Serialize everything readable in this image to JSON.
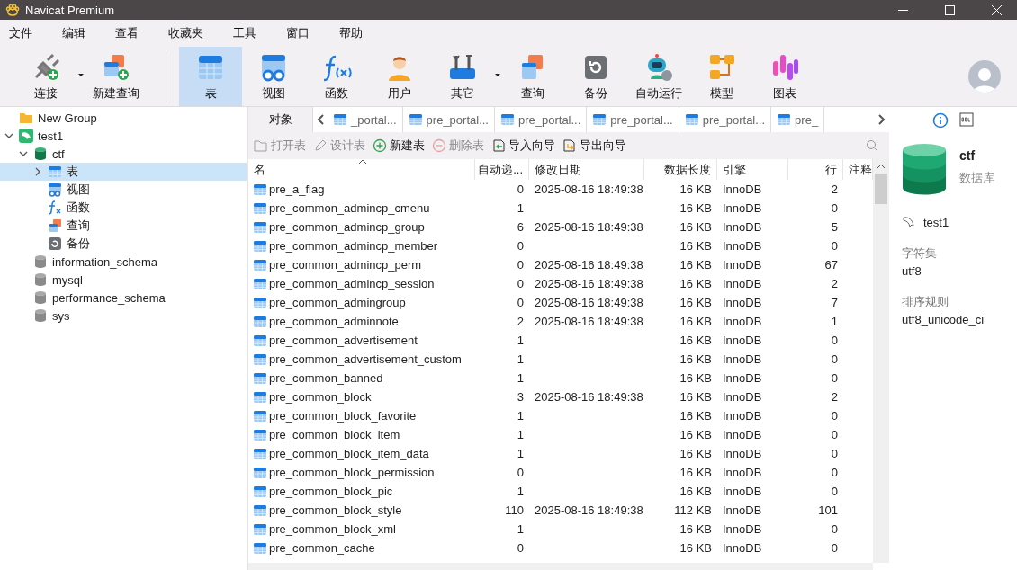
{
  "window": {
    "title": "Navicat Premium"
  },
  "menu": [
    "文件",
    "编辑",
    "查看",
    "收藏夹",
    "工具",
    "窗口",
    "帮助"
  ],
  "toolbar": [
    {
      "kind": "connect",
      "label": "连接",
      "has_menu": true,
      "selected": false
    },
    {
      "kind": "new-query",
      "label": "新建查询",
      "has_menu": false,
      "selected": false
    },
    {
      "kind": "table",
      "label": "表",
      "has_menu": false,
      "selected": true
    },
    {
      "kind": "view",
      "label": "视图",
      "has_menu": false,
      "selected": false
    },
    {
      "kind": "function",
      "label": "函数",
      "has_menu": false,
      "selected": false
    },
    {
      "kind": "user",
      "label": "用户",
      "has_menu": false,
      "selected": false
    },
    {
      "kind": "other",
      "label": "其它",
      "has_menu": true,
      "selected": false
    },
    {
      "kind": "query",
      "label": "查询",
      "has_menu": false,
      "selected": false
    },
    {
      "kind": "backup",
      "label": "备份",
      "has_menu": false,
      "selected": false
    },
    {
      "kind": "automation",
      "label": "自动运行",
      "has_menu": false,
      "selected": false
    },
    {
      "kind": "model",
      "label": "模型",
      "has_menu": false,
      "selected": false
    },
    {
      "kind": "chart",
      "label": "图表",
      "has_menu": false,
      "selected": false
    }
  ],
  "sidebar": {
    "items": [
      {
        "kind": "group",
        "label": "New Group",
        "selected": false
      },
      {
        "kind": "connection",
        "label": "test1",
        "expanded": true,
        "selected": false,
        "children": [
          {
            "kind": "database",
            "label": "ctf",
            "expanded": true,
            "selected": false,
            "children": [
              {
                "kind": "table",
                "label": "表",
                "expanded": false,
                "selected": true
              },
              {
                "kind": "view",
                "label": "视图",
                "selected": false
              },
              {
                "kind": "function",
                "label": "函数",
                "selected": false
              },
              {
                "kind": "query",
                "label": "查询",
                "selected": false
              },
              {
                "kind": "backup",
                "label": "备份",
                "selected": false
              }
            ]
          },
          {
            "kind": "database-closed",
            "label": "information_schema",
            "selected": false
          },
          {
            "kind": "database-closed",
            "label": "mysql",
            "selected": false
          },
          {
            "kind": "database-closed",
            "label": "performance_schema",
            "selected": false
          },
          {
            "kind": "database-closed",
            "label": "sys",
            "selected": false
          }
        ]
      }
    ]
  },
  "tabs": [
    {
      "kind": "objects",
      "label": "对象",
      "selected": true
    },
    {
      "kind": "table",
      "label": "_portal...",
      "selected": false
    },
    {
      "kind": "table",
      "label": "pre_portal...",
      "selected": false
    },
    {
      "kind": "table",
      "label": "pre_portal...",
      "selected": false
    },
    {
      "kind": "table",
      "label": "pre_portal...",
      "selected": false
    },
    {
      "kind": "table",
      "label": "pre_portal...",
      "selected": false
    },
    {
      "kind": "table",
      "label": "pre_",
      "selected": false
    }
  ],
  "actions": [
    {
      "kind": "open",
      "label": "打开表",
      "disabled": true
    },
    {
      "kind": "design",
      "label": "设计表",
      "disabled": true
    },
    {
      "kind": "new",
      "label": "新建表",
      "disabled": false
    },
    {
      "kind": "delete",
      "label": "删除表",
      "disabled": true
    },
    {
      "kind": "import",
      "label": "导入向导",
      "disabled": false
    },
    {
      "kind": "export",
      "label": "导出向导",
      "disabled": false
    }
  ],
  "table": {
    "columns": [
      "名",
      "自动递...",
      "修改日期",
      "数据长度",
      "引擎",
      "行",
      "注释"
    ],
    "rows": [
      [
        "pre_a_flag",
        "0",
        "2025-08-16 18:49:38",
        "16 KB",
        "InnoDB",
        "2"
      ],
      [
        "pre_common_admincp_cmenu",
        "1",
        "",
        "16 KB",
        "InnoDB",
        "0"
      ],
      [
        "pre_common_admincp_group",
        "6",
        "2025-08-16 18:49:38",
        "16 KB",
        "InnoDB",
        "5"
      ],
      [
        "pre_common_admincp_member",
        "0",
        "",
        "16 KB",
        "InnoDB",
        "0"
      ],
      [
        "pre_common_admincp_perm",
        "0",
        "2025-08-16 18:49:38",
        "16 KB",
        "InnoDB",
        "67"
      ],
      [
        "pre_common_admincp_session",
        "0",
        "2025-08-16 18:49:38",
        "16 KB",
        "InnoDB",
        "2"
      ],
      [
        "pre_common_admingroup",
        "0",
        "2025-08-16 18:49:38",
        "16 KB",
        "InnoDB",
        "7"
      ],
      [
        "pre_common_adminnote",
        "2",
        "2025-08-16 18:49:38",
        "16 KB",
        "InnoDB",
        "1"
      ],
      [
        "pre_common_advertisement",
        "1",
        "",
        "16 KB",
        "InnoDB",
        "0"
      ],
      [
        "pre_common_advertisement_custom",
        "1",
        "",
        "16 KB",
        "InnoDB",
        "0"
      ],
      [
        "pre_common_banned",
        "1",
        "",
        "16 KB",
        "InnoDB",
        "0"
      ],
      [
        "pre_common_block",
        "3",
        "2025-08-16 18:49:38",
        "16 KB",
        "InnoDB",
        "2"
      ],
      [
        "pre_common_block_favorite",
        "1",
        "",
        "16 KB",
        "InnoDB",
        "0"
      ],
      [
        "pre_common_block_item",
        "1",
        "",
        "16 KB",
        "InnoDB",
        "0"
      ],
      [
        "pre_common_block_item_data",
        "1",
        "",
        "16 KB",
        "InnoDB",
        "0"
      ],
      [
        "pre_common_block_permission",
        "0",
        "",
        "16 KB",
        "InnoDB",
        "0"
      ],
      [
        "pre_common_block_pic",
        "1",
        "",
        "16 KB",
        "InnoDB",
        "0"
      ],
      [
        "pre_common_block_style",
        "110",
        "2025-08-16 18:49:38",
        "112 KB",
        "InnoDB",
        "101"
      ],
      [
        "pre_common_block_xml",
        "1",
        "",
        "16 KB",
        "InnoDB",
        "0"
      ],
      [
        "pre_common_cache",
        "0",
        "",
        "16 KB",
        "InnoDB",
        "0"
      ]
    ]
  },
  "info": {
    "name": "ctf",
    "type": "数据库",
    "connection": "test1",
    "fields": [
      {
        "label": "字符集",
        "value": "utf8"
      },
      {
        "label": "排序规则",
        "value": "utf8_unicode_ci"
      }
    ]
  }
}
